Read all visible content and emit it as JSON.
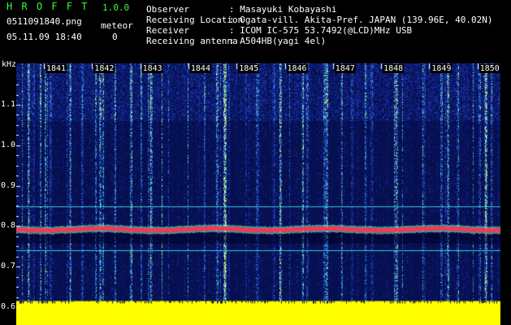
{
  "app": {
    "title": "H R O F F T",
    "version": "1.0.0"
  },
  "file": {
    "name": "0511091840.png",
    "datetime": "05.11.09 18:40"
  },
  "meteor": {
    "label": "meteor",
    "count": "0"
  },
  "station": {
    "observer_label": "Observer",
    "observer_value": ": Masayuki Kobayashi",
    "location_label": "Receiving Location",
    "location_value": ": Ogata-vill. Akita-Pref. JAPAN (139.96E, 40.02N)",
    "receiver_label": "Receiver",
    "receiver_value": ": ICOM IC-575 53.7492(@LCD)MHz USB",
    "antenna_label": "Receiving antenna",
    "antenna_value": ": A504HB(yagi 4el)"
  },
  "chart_data": {
    "type": "heatmap",
    "ylabel": "kHz",
    "yticks": [
      "1.1",
      "1.0",
      "0.9",
      "0.8",
      "0.7",
      "0.6"
    ],
    "xticks": [
      "1841",
      "1842",
      "1843",
      "1844",
      "1845",
      "1846",
      "1847",
      "1848",
      "1849",
      "1850"
    ],
    "carrier_khz": 0.793,
    "reference_lines_khz": [
      0.85,
      0.74
    ],
    "colors": {
      "background": "#08124f",
      "signal": "#ff3355",
      "marker": "#ffff00",
      "line": "#37c8d2"
    }
  }
}
